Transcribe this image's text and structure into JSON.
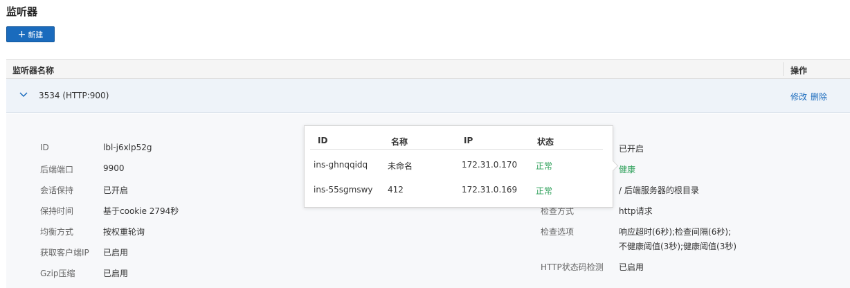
{
  "page": {
    "title": "监听器",
    "new_button": "新建"
  },
  "table": {
    "headers": {
      "name": "监听器名称",
      "ops": "操作"
    },
    "row": {
      "name": "3534 (HTTP:900)",
      "edit": "修改",
      "delete": "删除"
    }
  },
  "detail": {
    "left": [
      {
        "key": "ID",
        "value": "lbl-j6xlp52g"
      },
      {
        "key": "后端端口",
        "value": "9900"
      },
      {
        "key": "会话保持",
        "value": "已开启"
      },
      {
        "key": "保持时间",
        "value": "基于cookie 2794秒"
      },
      {
        "key": "均衡方式",
        "value": "按权重轮询"
      },
      {
        "key": "获取客户端IP",
        "value": "已启用"
      },
      {
        "key": "Gzip压缩",
        "value": "已启用"
      }
    ],
    "right": {
      "health_check_value": "已开启",
      "health_status": "健康",
      "check_path": "/  后端服务器的根目录",
      "check_method_key": "检查方式",
      "check_method_value": "http请求",
      "check_options_key": "检查选项",
      "check_options_line1": "响应超时(6秒);检查间隔(6秒);",
      "check_options_line2": "不健康阈值(3秒);健康阈值(3秒)",
      "http_code_key": "HTTP状态码检测",
      "http_code_value": "已启用"
    }
  },
  "popover": {
    "headers": {
      "id": "ID",
      "name": "名称",
      "ip": "IP",
      "status": "状态"
    },
    "rows": [
      {
        "id": "ins-ghnqqidq",
        "name": "未命名",
        "ip": "172.31.0.170",
        "status": "正常"
      },
      {
        "id": "ins-55sgmswy",
        "name": "412",
        "ip": "172.31.0.169",
        "status": "正常"
      }
    ]
  },
  "colors": {
    "primary": "#1a6bbd",
    "healthy": "#2ea05a"
  }
}
